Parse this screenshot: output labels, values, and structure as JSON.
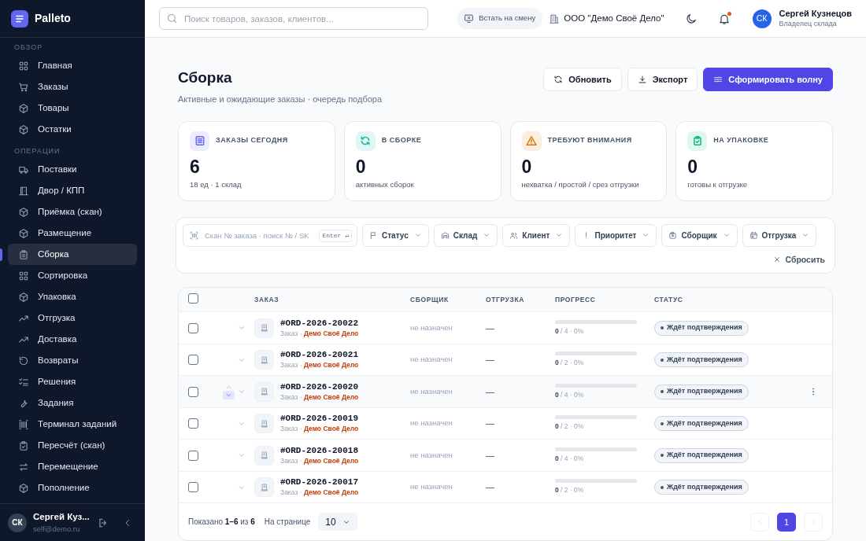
{
  "sidebar": {
    "brand": "Palleto",
    "sections": [
      {
        "title": "ОБЗОР",
        "items": [
          {
            "label": "Главная",
            "selected": false
          },
          {
            "label": "Заказы",
            "selected": false
          },
          {
            "label": "Товары",
            "selected": false
          },
          {
            "label": "Остатки",
            "selected": false
          }
        ]
      },
      {
        "title": "ОПЕРАЦИИ",
        "items": [
          {
            "label": "Поставки",
            "selected": false
          },
          {
            "label": "Двор / КПП",
            "selected": false
          },
          {
            "label": "Приёмка (скан)",
            "selected": false
          },
          {
            "label": "Размещение",
            "selected": false
          },
          {
            "label": "Сборка",
            "selected": true
          },
          {
            "label": "Сортировка",
            "selected": false
          },
          {
            "label": "Упаковка",
            "selected": false
          },
          {
            "label": "Отгрузка",
            "selected": false
          },
          {
            "label": "Доставка",
            "selected": false
          },
          {
            "label": "Возвраты",
            "selected": false
          },
          {
            "label": "Решения",
            "selected": false
          },
          {
            "label": "Задания",
            "selected": false
          },
          {
            "label": "Терминал заданий",
            "selected": false
          },
          {
            "label": "Пересчёт (скан)",
            "selected": false
          },
          {
            "label": "Перемещение",
            "selected": false
          },
          {
            "label": "Пополнение",
            "selected": false
          }
        ]
      }
    ],
    "user": {
      "initials": "СК",
      "name": "Сергей Куз...",
      "email": "self@demo.ru"
    }
  },
  "topbar": {
    "search": {
      "placeholder": "Поиск товаров, заказов, клиентов..."
    },
    "shift_button": "Встать на смену",
    "company": "ООО \"Демо Своё Дело\"",
    "has_unread": true,
    "user": {
      "initials": "СК",
      "name": "Сергей Кузнецов",
      "role": "Владелец склада"
    }
  },
  "page": {
    "title": "Сборка",
    "subtitle": "Активные и ожидающие заказы · очередь подбора",
    "buttons": [
      {
        "label": "Обновить",
        "kind": "secondary"
      },
      {
        "label": "Экспорт",
        "kind": "secondary"
      },
      {
        "label": "Сформировать волну",
        "kind": "primary"
      }
    ]
  },
  "stats": [
    {
      "label": "ЗАКАЗЫ СЕГОДНЯ",
      "value": "6",
      "note": "18 ед · 1 склад",
      "color": "#6366f1"
    },
    {
      "label": "В СБОРКЕ",
      "value": "0",
      "note": "активных сборок",
      "color": "#14b8a6"
    },
    {
      "label": "ТРЕБУЮТ ВНИМАНИЯ",
      "value": "0",
      "note": "нехватка / простой / срез отгрузки",
      "color": "#d97706"
    },
    {
      "label": "НА УПАКОВКЕ",
      "value": "0",
      "note": "готовы к отгрузке",
      "color": "#10b981"
    }
  ],
  "filters": {
    "scan": {
      "placeholder": "Скан № заказа · поиск № / SK",
      "key": "Enter ↵"
    },
    "dropdowns": [
      "Статус",
      "Склад",
      "Клиент",
      "Приоритет",
      "Сборщик",
      "Отгрузка"
    ],
    "reset": "Сбросить"
  },
  "table": {
    "select_all": false,
    "columns": [
      "ЗАКАЗ",
      "СБОРЩИК",
      "ОТГРУЗКА",
      "ПРОГРЕСС",
      "СТАТУС"
    ],
    "rows": [
      {
        "checked": false,
        "hovered": false,
        "number": "#ORD-2026-20022",
        "type": "Заказ ·",
        "client": "Демо Своё Дело",
        "picker": "не назначен",
        "shipment": "—",
        "progress": "**0** / 4 · 0%",
        "level": 0,
        "status": "Ждёт подтверждения"
      },
      {
        "checked": false,
        "hovered": false,
        "number": "#ORD-2026-20021",
        "type": "Заказ ·",
        "client": "Демо Своё Дело",
        "picker": "не назначен",
        "shipment": "—",
        "progress": "**0** / 2 · 0%",
        "level": 0,
        "status": "Ждёт подтверждения"
      },
      {
        "checked": false,
        "hovered": true,
        "number": "#ORD-2026-20020",
        "type": "Заказ ·",
        "client": "Демо Своё Дело",
        "picker": "не назначен",
        "shipment": "—",
        "progress": "**0** / 4 · 0%",
        "level": 0,
        "status": "Ждёт подтверждения"
      },
      {
        "checked": false,
        "hovered": false,
        "number": "#ORD-2026-20019",
        "type": "Заказ ·",
        "client": "Демо Своё Дело",
        "picker": "не назначен",
        "shipment": "—",
        "progress": "**0** / 2 · 0%",
        "level": 0,
        "status": "Ждёт подтверждения"
      },
      {
        "checked": false,
        "hovered": false,
        "number": "#ORD-2026-20018",
        "type": "Заказ ·",
        "client": "Демо Своё Дело",
        "picker": "не назначен",
        "shipment": "—",
        "progress": "**0** / 4 · 0%",
        "level": 0,
        "status": "Ждёт подтверждения"
      },
      {
        "checked": false,
        "hovered": false,
        "number": "#ORD-2026-20017",
        "type": "Заказ ·",
        "client": "Демо Своё Дело",
        "picker": "не назначен",
        "shipment": "—",
        "progress": "**0** / 2 · 0%",
        "level": 0,
        "status": "Ждёт подтверждения"
      }
    ]
  },
  "pagination": {
    "summary": "Показано **1–6** из **6**",
    "per_page_label": "На странице",
    "per_page": "10",
    "pages": [
      {
        "label": "1",
        "selected": true
      }
    ]
  }
}
